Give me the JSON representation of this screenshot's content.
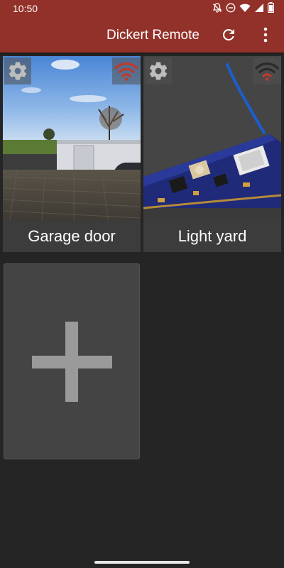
{
  "status_bar": {
    "time": "10:50",
    "icons": [
      "bell-off-icon",
      "do-not-disturb-icon",
      "wifi-icon",
      "signal-icon",
      "battery-icon"
    ]
  },
  "app_bar": {
    "title": "Dickert Remote",
    "actions": [
      "refresh-icon",
      "more-vert-icon"
    ],
    "color": "#923129"
  },
  "devices": [
    {
      "label": "Garage door",
      "signal_color": "#c0392b",
      "image": "garage-photo"
    },
    {
      "label": "Light yard",
      "signal_color": "#c0392b",
      "image": "circuit-board-photo"
    }
  ],
  "add_tile": {
    "icon": "plus-icon"
  }
}
